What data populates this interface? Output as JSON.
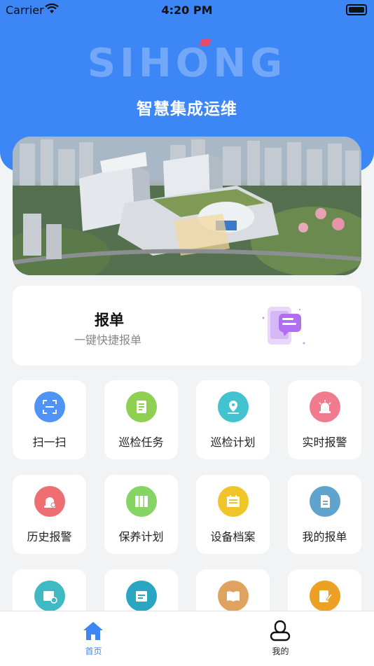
{
  "status_bar": {
    "carrier": "Carrier",
    "time": "4:20 PM"
  },
  "header": {
    "logo_text": "SIHONG",
    "title": "智慧集成运维"
  },
  "report_card": {
    "title": "报单",
    "subtitle": "一键快捷报单"
  },
  "grid": [
    {
      "label": "扫一扫",
      "icon": "scan-icon",
      "color": "#4f93f7"
    },
    {
      "label": "巡检任务",
      "icon": "inspection-task-icon",
      "color": "#8fcf52"
    },
    {
      "label": "巡检计划",
      "icon": "location-pin-icon",
      "color": "#42c3cf"
    },
    {
      "label": "实时报警",
      "icon": "alarm-light-icon",
      "color": "#f07a8e"
    },
    {
      "label": "历史报警",
      "icon": "alarm-history-icon",
      "color": "#ee6e72"
    },
    {
      "label": "保养计划",
      "icon": "maintenance-binder-icon",
      "color": "#86d463"
    },
    {
      "label": "设备档案",
      "icon": "device-archive-icon",
      "color": "#f0c52a"
    },
    {
      "label": "我的报单",
      "icon": "document-icon",
      "color": "#5fa3cf"
    },
    {
      "label": "",
      "icon": "calendar-clock-icon",
      "color": "#3fb9c4"
    },
    {
      "label": "",
      "icon": "schedule-icon",
      "color": "#2aa6c2"
    },
    {
      "label": "",
      "icon": "book-icon",
      "color": "#e0a25f"
    },
    {
      "label": "",
      "icon": "note-edit-icon",
      "color": "#eea023"
    }
  ],
  "tab_bar": {
    "tabs": [
      {
        "label": "首页",
        "icon": "home-icon",
        "active": true
      },
      {
        "label": "我的",
        "icon": "user-icon",
        "active": false
      }
    ],
    "active_color": "#3d86f5"
  }
}
